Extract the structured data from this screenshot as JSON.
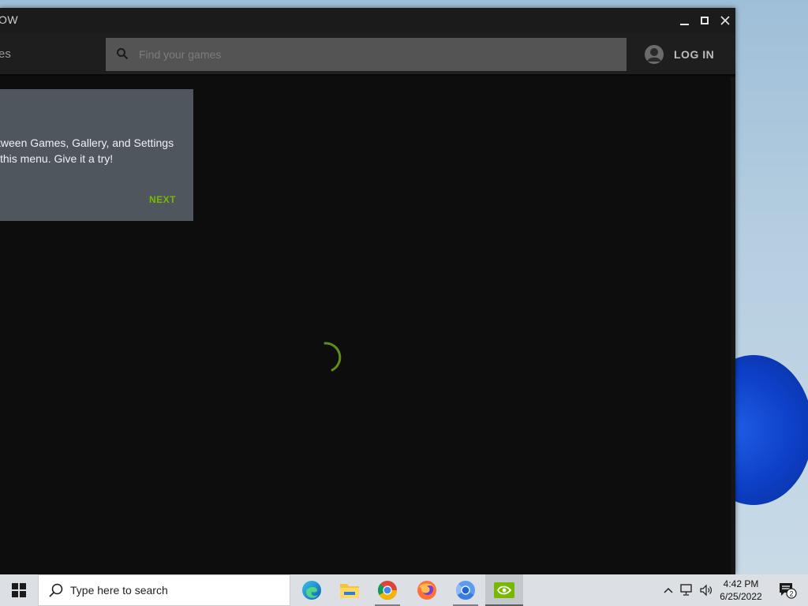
{
  "window": {
    "title": "OW",
    "nav_games": "es",
    "search": {
      "placeholder": "Find your games",
      "value": ""
    },
    "login_label": "LOG IN"
  },
  "coach_mark": {
    "line1": "tween Games, Gallery, and Settings",
    "line2": "this menu. Give it a try!",
    "next_label": "NEXT"
  },
  "colors": {
    "accent": "#76b900",
    "window_bg": "#0d0d0d",
    "coach_bg": "#4f565e"
  },
  "taskbar": {
    "search_label": "Type here to search",
    "apps": [
      {
        "name": "edge-icon",
        "state": "normal"
      },
      {
        "name": "file-explorer-icon",
        "state": "normal"
      },
      {
        "name": "chrome-icon",
        "state": "running"
      },
      {
        "name": "firefox-icon",
        "state": "normal"
      },
      {
        "name": "chromium-icon",
        "state": "running"
      },
      {
        "name": "nvidia-icon",
        "state": "active"
      }
    ],
    "time": "4:42 PM",
    "date": "6/25/2022",
    "notification_count": "2"
  }
}
